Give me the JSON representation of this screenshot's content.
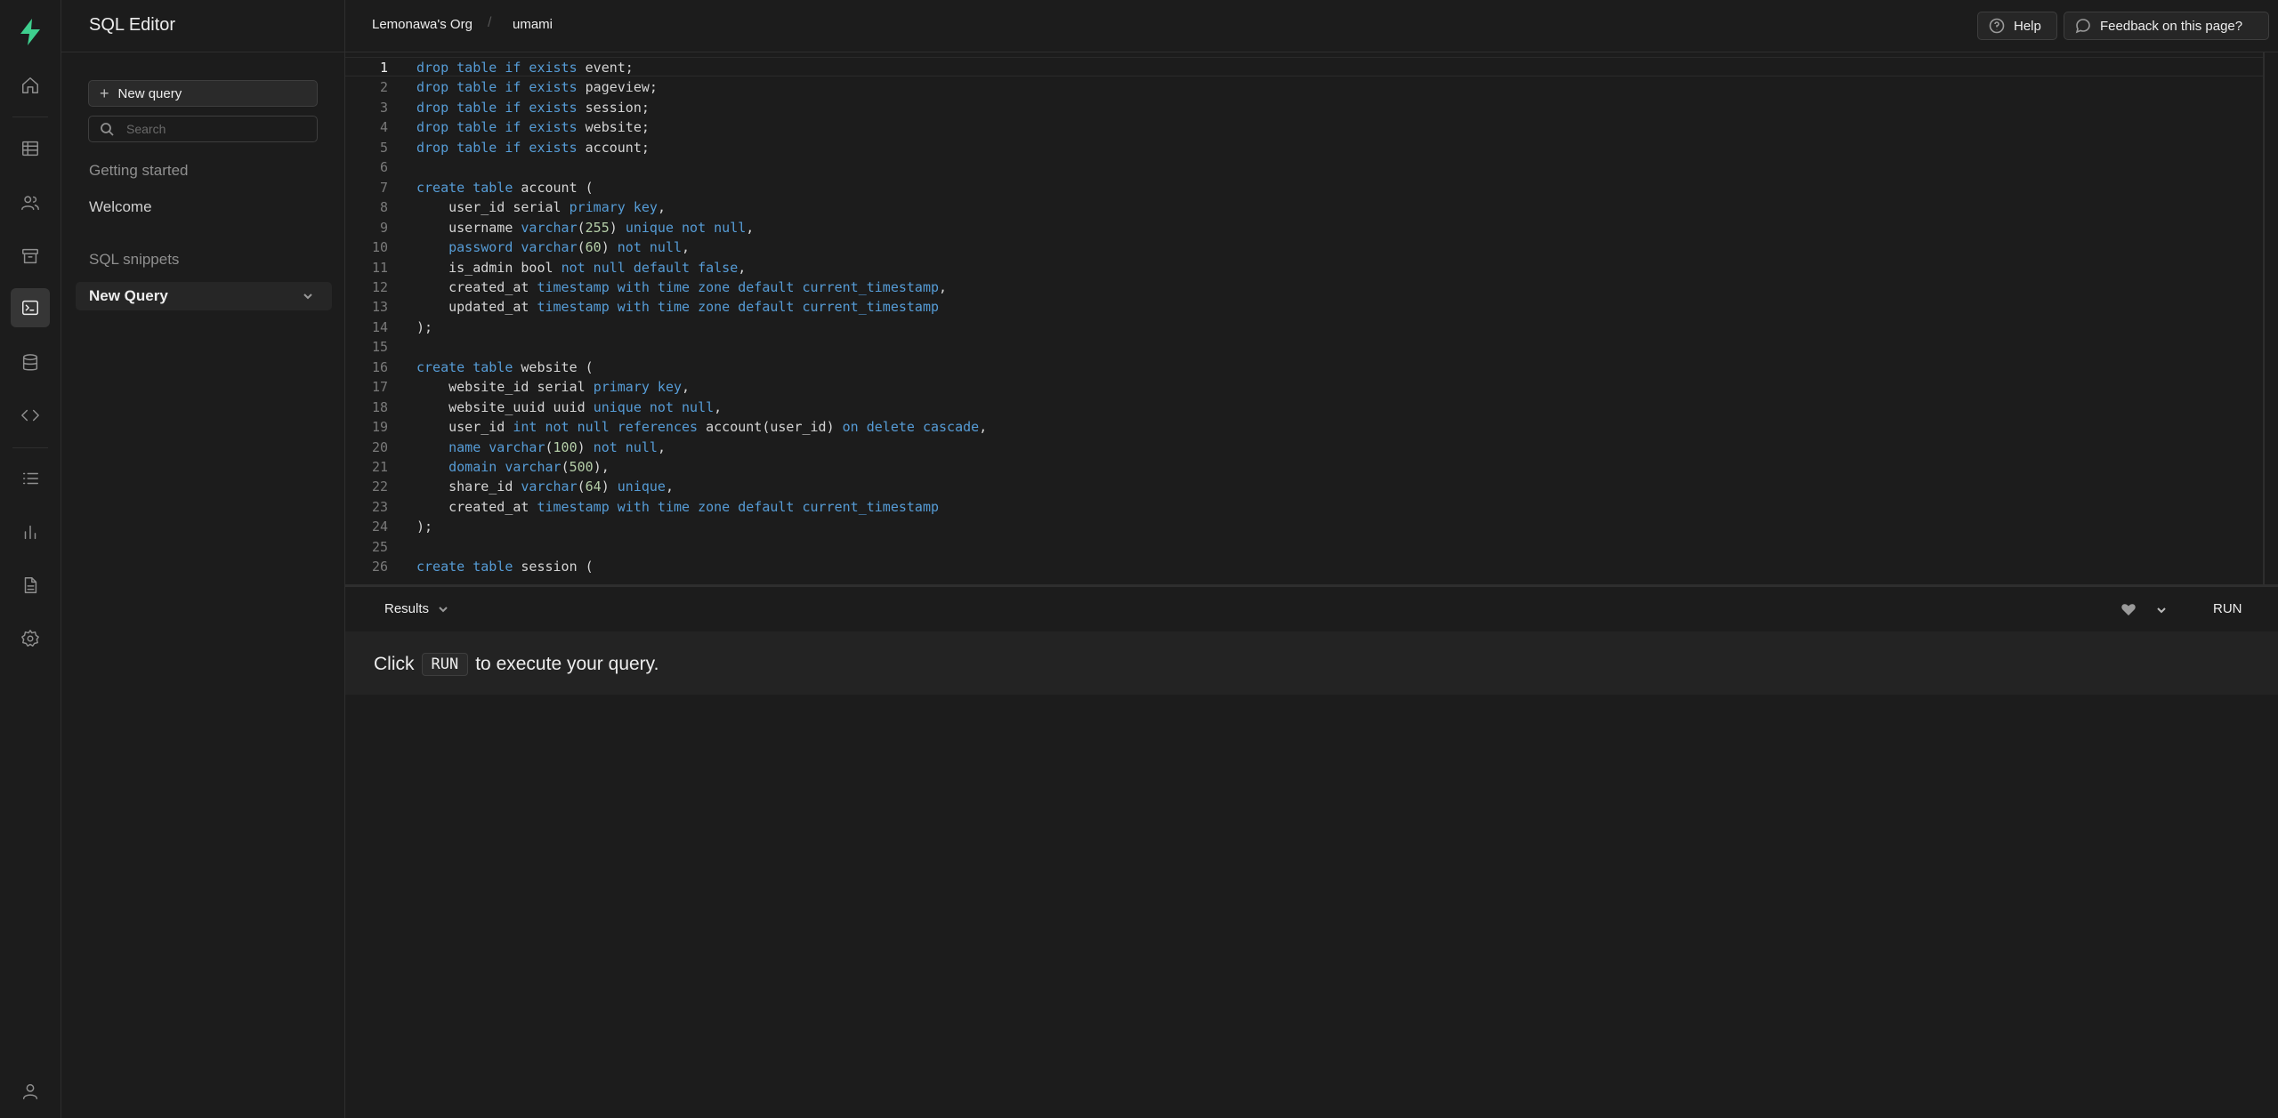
{
  "sidebar": {
    "title": "SQL Editor",
    "new_query_label": "New query",
    "search_placeholder": "Search",
    "section_getting_started": "Getting started",
    "welcome": "Welcome",
    "section_snippets": "SQL snippets",
    "snippet_active": "New Query"
  },
  "header": {
    "org": "Lemonawa's Org",
    "separator": "/",
    "project": "umami",
    "help": "Help",
    "feedback": "Feedback on this page?"
  },
  "editor": {
    "active_line": 1,
    "lines": [
      [
        [
          "kw",
          "drop table if exists "
        ],
        [
          "t",
          "event;"
        ]
      ],
      [
        [
          "kw",
          "drop table if exists "
        ],
        [
          "t",
          "pageview;"
        ]
      ],
      [
        [
          "kw",
          "drop table if exists "
        ],
        [
          "t",
          "session;"
        ]
      ],
      [
        [
          "kw",
          "drop table if exists "
        ],
        [
          "t",
          "website;"
        ]
      ],
      [
        [
          "kw",
          "drop table if exists "
        ],
        [
          "t",
          "account;"
        ]
      ],
      [],
      [
        [
          "kw",
          "create table "
        ],
        [
          "t",
          "account ("
        ]
      ],
      [
        [
          "t",
          "    user_id serial "
        ],
        [
          "kw",
          "primary key"
        ],
        [
          "t",
          ","
        ]
      ],
      [
        [
          "t",
          "    username "
        ],
        [
          "kw",
          "varchar"
        ],
        [
          "t",
          "("
        ],
        [
          "num",
          "255"
        ],
        [
          "t",
          ") "
        ],
        [
          "kw",
          "unique not null"
        ],
        [
          "t",
          ","
        ]
      ],
      [
        [
          "t",
          "    "
        ],
        [
          "kw",
          "password varchar"
        ],
        [
          "t",
          "("
        ],
        [
          "num",
          "60"
        ],
        [
          "t",
          ") "
        ],
        [
          "kw",
          "not null"
        ],
        [
          "t",
          ","
        ]
      ],
      [
        [
          "t",
          "    is_admin bool "
        ],
        [
          "kw",
          "not null default false"
        ],
        [
          "t",
          ","
        ]
      ],
      [
        [
          "t",
          "    created_at "
        ],
        [
          "kw",
          "timestamp with time zone default current_timestamp"
        ],
        [
          "t",
          ","
        ]
      ],
      [
        [
          "t",
          "    updated_at "
        ],
        [
          "kw",
          "timestamp with time zone default current_timestamp"
        ]
      ],
      [
        [
          "t",
          ");"
        ]
      ],
      [],
      [
        [
          "kw",
          "create table "
        ],
        [
          "t",
          "website ("
        ]
      ],
      [
        [
          "t",
          "    website_id serial "
        ],
        [
          "kw",
          "primary key"
        ],
        [
          "t",
          ","
        ]
      ],
      [
        [
          "t",
          "    website_uuid uuid "
        ],
        [
          "kw",
          "unique not null"
        ],
        [
          "t",
          ","
        ]
      ],
      [
        [
          "t",
          "    user_id "
        ],
        [
          "kw",
          "int not null references "
        ],
        [
          "t",
          "account(user_id) "
        ],
        [
          "kw",
          "on delete cascade"
        ],
        [
          "t",
          ","
        ]
      ],
      [
        [
          "t",
          "    "
        ],
        [
          "kw",
          "name varchar"
        ],
        [
          "t",
          "("
        ],
        [
          "num",
          "100"
        ],
        [
          "t",
          ") "
        ],
        [
          "kw",
          "not null"
        ],
        [
          "t",
          ","
        ]
      ],
      [
        [
          "t",
          "    "
        ],
        [
          "kw",
          "domain varchar"
        ],
        [
          "t",
          "("
        ],
        [
          "num",
          "500"
        ],
        [
          "t",
          "),"
        ]
      ],
      [
        [
          "t",
          "    share_id "
        ],
        [
          "kw",
          "varchar"
        ],
        [
          "t",
          "("
        ],
        [
          "num",
          "64"
        ],
        [
          "t",
          ") "
        ],
        [
          "kw",
          "unique"
        ],
        [
          "t",
          ","
        ]
      ],
      [
        [
          "t",
          "    created_at "
        ],
        [
          "kw",
          "timestamp with time zone default current_timestamp"
        ]
      ],
      [
        [
          "t",
          ");"
        ]
      ],
      [],
      [
        [
          "kw",
          "create table "
        ],
        [
          "t",
          "session ("
        ]
      ]
    ]
  },
  "results": {
    "tab_label": "Results",
    "run_label": "RUN",
    "hint_prefix": "Click",
    "hint_key": "RUN",
    "hint_suffix": "to execute your query."
  },
  "icons": {
    "rail": [
      "home-icon",
      "table-editor-icon",
      "users-icon",
      "storage-icon",
      "sql-editor-icon",
      "database-icon",
      "code-icon",
      "logs-icon",
      "reports-icon",
      "docs-icon",
      "settings-icon",
      "account-icon"
    ]
  },
  "colors": {
    "brand": "#3ecf8e",
    "keyword": "#569cd6",
    "number": "#b5cea8"
  }
}
